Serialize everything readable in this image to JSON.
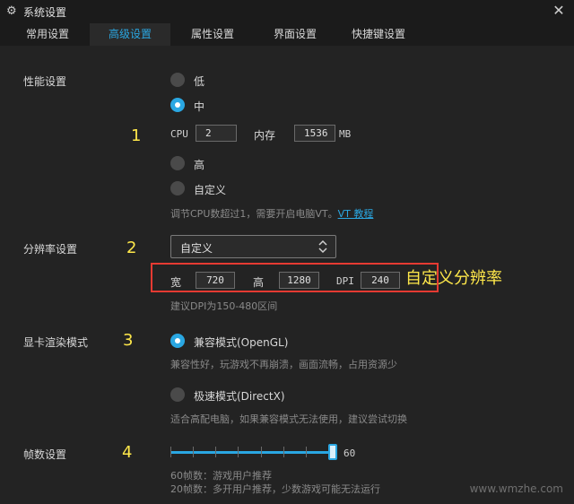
{
  "window": {
    "title": "系统设置",
    "settings_icon": "gear-icon",
    "close_icon": "close-icon",
    "close_glyph": "✕"
  },
  "tabs": [
    {
      "label": "常用设置",
      "active": false
    },
    {
      "label": "高级设置",
      "active": true
    },
    {
      "label": "属性设置",
      "active": false
    },
    {
      "label": "界面设置",
      "active": false
    },
    {
      "label": "快捷键设置",
      "active": false
    }
  ],
  "performance": {
    "label": "性能设置",
    "annotation_number": "1",
    "options": {
      "low": "低",
      "medium": "中",
      "high": "高",
      "custom": "自定义"
    },
    "selected": "medium",
    "cpu_label": "CPU",
    "cpu_value": "2",
    "memory_label": "内存",
    "memory_value": "1536",
    "memory_unit": "MB",
    "hint_prefix": "调节CPU数超过1，需要开启电脑VT。",
    "hint_link": "VT 教程"
  },
  "resolution": {
    "label": "分辨率设置",
    "annotation_number": "2",
    "selected_value": "自定义",
    "width_label": "宽",
    "width_value": "720",
    "height_label": "高",
    "height_value": "1280",
    "dpi_label": "DPI",
    "dpi_value": "240",
    "hint": "建议DPI为150-480区间",
    "annotation_text": "自定义分辨率"
  },
  "render_mode": {
    "label": "显卡渲染模式",
    "annotation_number": "3",
    "compat_label": "兼容模式(OpenGL)",
    "compat_hint": "兼容性好，玩游戏不再崩溃，画面流畅，占用资源少",
    "speed_label": "极速模式(DirectX)",
    "speed_hint": "适合高配电脑，如果兼容模式无法使用，建议尝试切换",
    "selected": "compat"
  },
  "fps": {
    "label": "帧数设置",
    "annotation_number": "4",
    "value": 60,
    "value_text": "60",
    "hint1": "60帧数：游戏用户推荐",
    "hint2": "20帧数：多开用户推荐，少数游戏可能无法运行"
  },
  "watermark": "www.wmzhe.com",
  "colors": {
    "accent": "#2aa7e2",
    "annotation": "#ffe84a",
    "highlight_box": "#e53a32",
    "background": "#232323"
  }
}
